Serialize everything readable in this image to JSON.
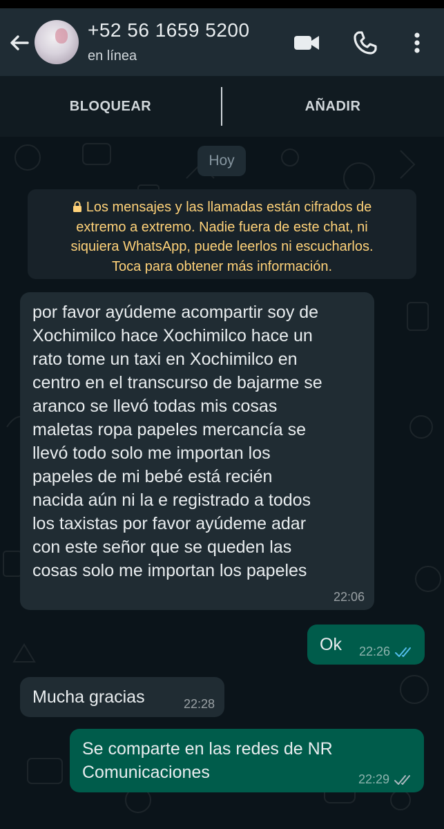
{
  "header": {
    "contact_name": "+52 56 1659 5200",
    "status": "en línea"
  },
  "actions": {
    "block_label": "BLOQUEAR",
    "add_label": "AÑADIR"
  },
  "chat": {
    "date_chip": "Hoy",
    "encryption_notice": "Los mensajes y las llamadas están cifrados de\nextremo a extremo. Nadie fuera de este chat, ni\nsiquiera WhatsApp, puede leerlos ni escucharlos.\nToca para obtener más información.",
    "messages": [
      {
        "direction": "incoming",
        "text": "por favor ayúdeme acompartir soy de\nXochimilco hace Xochimilco hace un\nrato tome un taxi en Xochimilco en\ncentro en el transcurso de bajarme se\naranco se llevó todas mis cosas\nmaletas ropa papeles mercancía se\nllevó todo solo me importan los\npapeles de mi bebé está recién\nnacida aún ni la e registrado a todos\nlos taxistas por favor ayúdeme adar\ncon este señor que se queden las\ncosas solo me importan los papeles",
        "time": "22:06"
      },
      {
        "direction": "outgoing",
        "text": "Ok",
        "time": "22:26",
        "status": "read"
      },
      {
        "direction": "incoming",
        "text": "Mucha gracias",
        "time": "22:28"
      },
      {
        "direction": "outgoing",
        "text": "Se comparte en las redes de NR\nComunicaciones",
        "time": "22:29",
        "status": "delivered"
      }
    ]
  },
  "colors": {
    "header_bg": "#1f2c34",
    "chat_bg": "#0b141a",
    "incoming_bubble": "#202c33",
    "outgoing_bubble": "#005c4b",
    "notice_text": "#ffd279",
    "read_ticks": "#53bdeb"
  },
  "icons": [
    "back-arrow-icon",
    "video-call-icon",
    "phone-call-icon",
    "more-options-icon",
    "lock-icon",
    "double-check-icon"
  ]
}
